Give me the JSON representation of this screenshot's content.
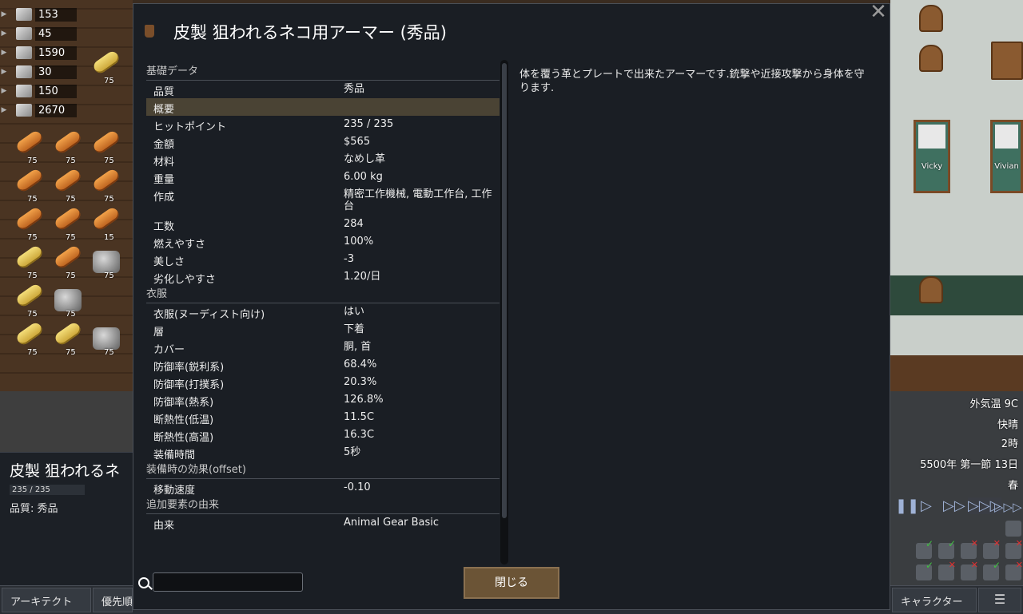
{
  "resources": [
    {
      "name": "silver-icon",
      "value": "153"
    },
    {
      "name": "steel-icon",
      "value": "45"
    },
    {
      "name": "cloth-icon",
      "value": "1590"
    },
    {
      "name": "medicine-icon",
      "value": "30"
    },
    {
      "name": "component-icon",
      "value": "150"
    },
    {
      "name": "wood-icon",
      "value": "2670"
    }
  ],
  "stack_labels": {
    "s75": "75",
    "s15": "15"
  },
  "beds": [
    {
      "name": "Vicky"
    },
    {
      "name": "Vivian"
    }
  ],
  "inspect": {
    "title": "皮製 狙われるネ",
    "hp": "235 / 235",
    "quality": "品質: 秀品"
  },
  "menubar": {
    "architect": "アーキテクト",
    "priority": "優先順",
    "character": "キャラクター"
  },
  "weather": {
    "temp": "外気温 9C",
    "condition": "快晴",
    "hour": "2時",
    "date": "5500年 第一節 13日",
    "season": "春"
  },
  "dialog": {
    "title": "皮製 狙われるネコ用アーマー (秀品)",
    "close_label": "閉じる",
    "description": "体を覆う革とプレートで出来たアーマーです.銃撃や近接攻撃から身体を守ります.",
    "search": {
      "value": "",
      "placeholder": ""
    },
    "sections": [
      {
        "header": "基礎データ",
        "rows": [
          {
            "label": "品質",
            "value": "秀品"
          },
          {
            "label": "概要",
            "value": ""
          },
          {
            "label": "ヒットポイント",
            "value": "235 / 235"
          },
          {
            "label": "金額",
            "value": "$565"
          },
          {
            "label": "材料",
            "value": "なめし革"
          },
          {
            "label": "重量",
            "value": "6.00 kg"
          },
          {
            "label": "作成",
            "value": "精密工作機械, 電動工作台, 工作台"
          },
          {
            "label": "工数",
            "value": "284"
          },
          {
            "label": "燃えやすさ",
            "value": "100%"
          },
          {
            "label": "美しさ",
            "value": "-3"
          },
          {
            "label": "劣化しやすさ",
            "value": "1.20/日"
          }
        ]
      },
      {
        "header": "衣服",
        "rows": [
          {
            "label": "衣服(ヌーディスト向け)",
            "value": "はい"
          },
          {
            "label": "層",
            "value": "下着"
          },
          {
            "label": "カバー",
            "value": "胴, 首"
          },
          {
            "label": "防御率(鋭利系)",
            "value": "68.4%"
          },
          {
            "label": "防御率(打撲系)",
            "value": "20.3%"
          },
          {
            "label": "防御率(熱系)",
            "value": "126.8%"
          },
          {
            "label": "断熱性(低温)",
            "value": "11.5C"
          },
          {
            "label": "断熱性(高温)",
            "value": "16.3C"
          },
          {
            "label": "装備時間",
            "value": "5秒"
          }
        ]
      },
      {
        "header": "装備時の効果(offset)",
        "rows": [
          {
            "label": "移動速度",
            "value": "-0.10"
          }
        ]
      },
      {
        "header": "追加要素の由来",
        "rows": [
          {
            "label": "由来",
            "value": "Animal Gear Basic"
          }
        ]
      }
    ]
  }
}
